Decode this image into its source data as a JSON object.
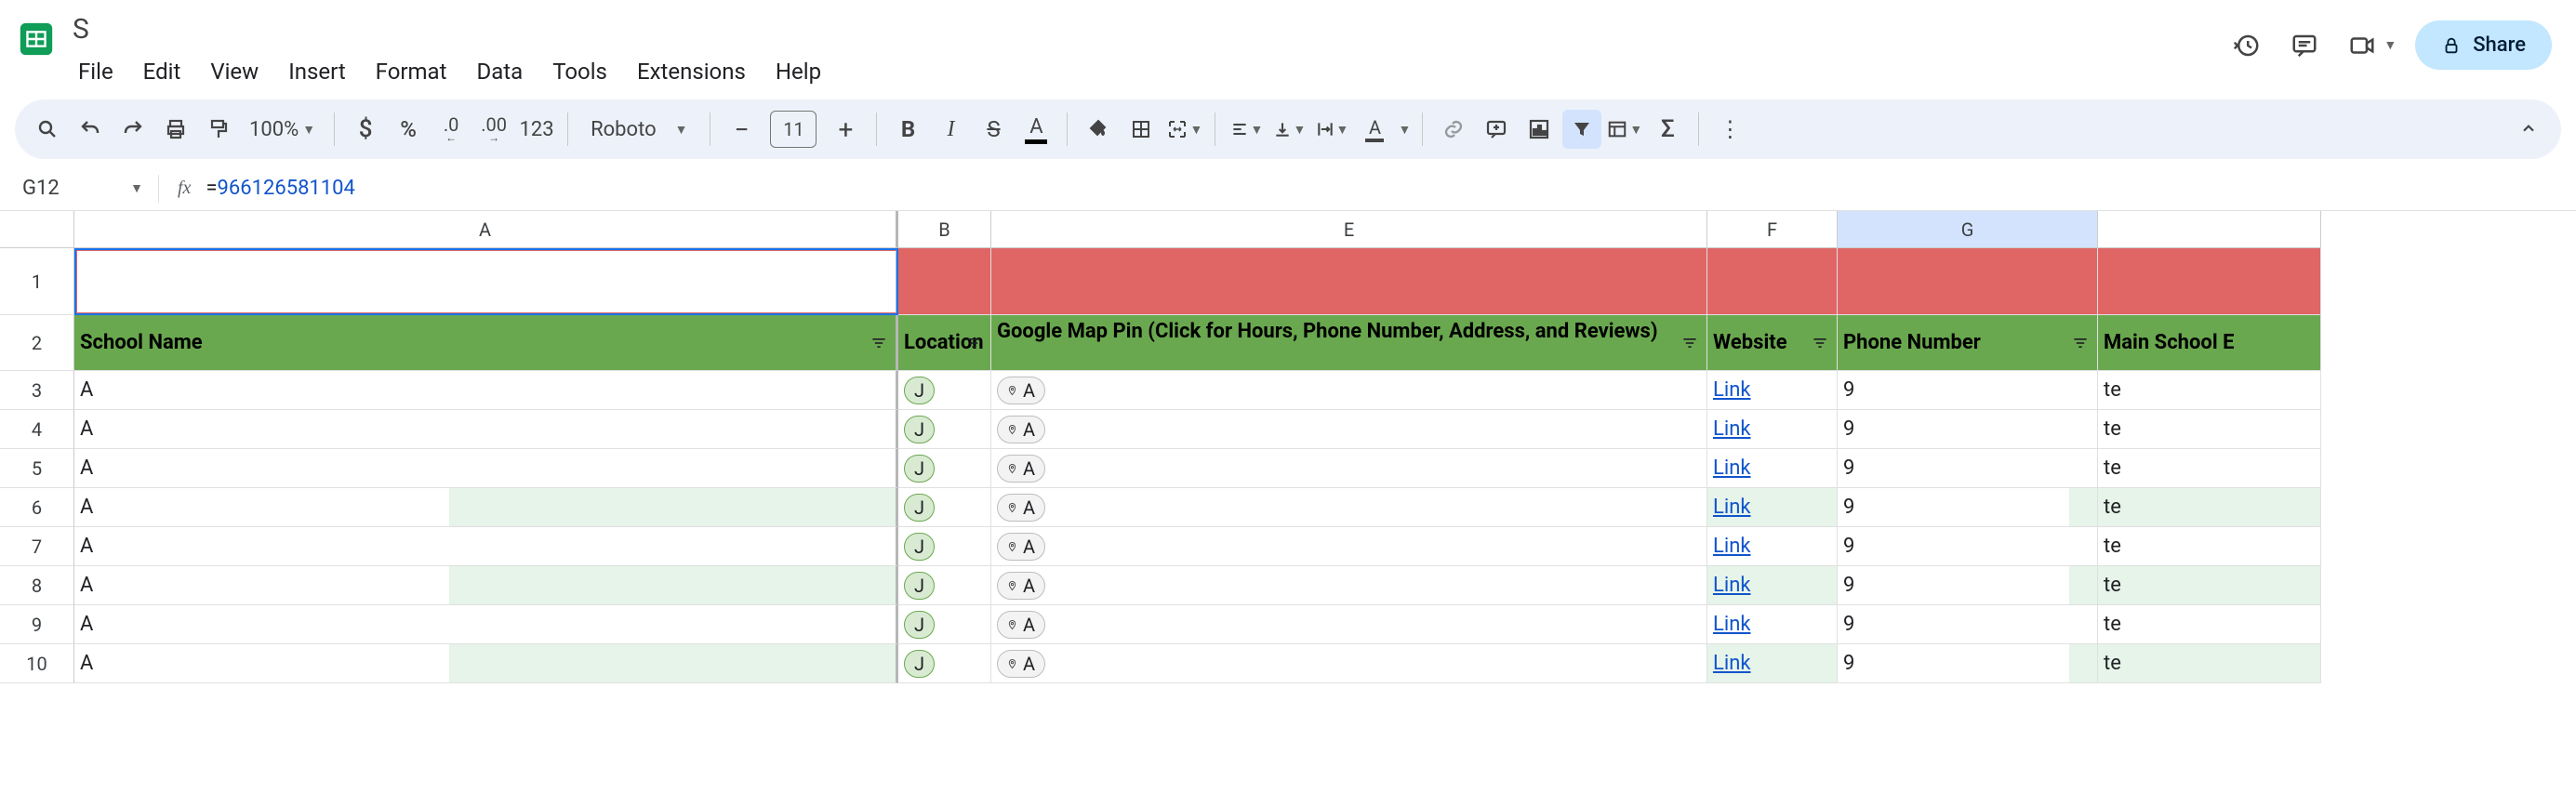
{
  "doc_title": "S",
  "menus": [
    "File",
    "Edit",
    "View",
    "Insert",
    "Format",
    "Data",
    "Tools",
    "Extensions",
    "Help"
  ],
  "share_label": "Share",
  "toolbar": {
    "zoom": "100%",
    "font": "Roboto",
    "font_size": "11",
    "decimal_dec": ".0",
    "decimal_inc": ".00",
    "format_123": "123"
  },
  "name_box": "G12",
  "formula": {
    "full": "=966126581104",
    "number": "966126581104"
  },
  "columns": {
    "A": "A",
    "B": "B",
    "E": "E",
    "F": "F",
    "G": "G"
  },
  "headers": {
    "A": "School Name",
    "B": "Location",
    "E": "Google Map Pin (Click for Hours, Phone Number, Address, and Reviews)",
    "F": "Website",
    "G": "Phone Number",
    "H": "Main School E"
  },
  "rows": [
    {
      "n": 3,
      "a": "A",
      "b": "J",
      "e": "A",
      "f": "Link",
      "g": "9",
      "h": "te",
      "alt": false
    },
    {
      "n": 4,
      "a": "A",
      "b": "J",
      "e": "A",
      "f": "Link",
      "g": "9",
      "h": "te",
      "alt": false
    },
    {
      "n": 5,
      "a": "A",
      "b": "J",
      "e": "A",
      "f": "Link",
      "g": "9",
      "h": "te",
      "alt": false
    },
    {
      "n": 6,
      "a": "A",
      "b": "J",
      "e": "A",
      "f": "Link",
      "g": "9",
      "h": "te",
      "alt": true
    },
    {
      "n": 7,
      "a": "A",
      "b": "J",
      "e": "A",
      "f": "Link",
      "g": "9",
      "h": "te",
      "alt": false
    },
    {
      "n": 8,
      "a": "A",
      "b": "J",
      "e": "A",
      "f": "Link",
      "g": "9",
      "h": "te",
      "alt": true
    },
    {
      "n": 9,
      "a": "A",
      "b": "J",
      "e": "A",
      "f": "Link",
      "g": "9",
      "h": "te",
      "alt": false
    },
    {
      "n": 10,
      "a": "A",
      "b": "J",
      "e": "A",
      "f": "Link",
      "g": "9",
      "h": "te",
      "alt": true
    }
  ]
}
